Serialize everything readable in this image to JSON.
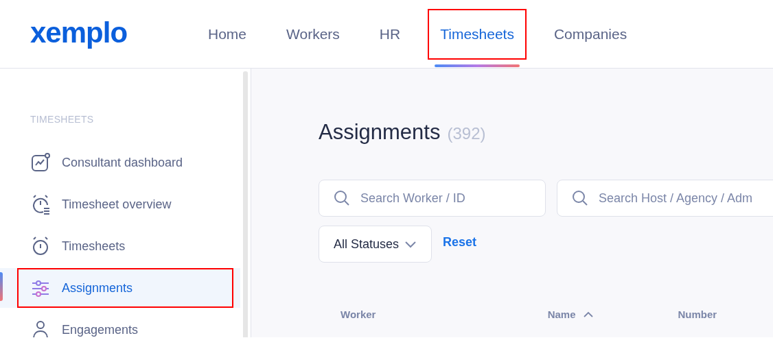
{
  "logo": "xemplo",
  "nav": [
    {
      "label": "Home",
      "selected": false,
      "highlighted": false
    },
    {
      "label": "Workers",
      "selected": false,
      "highlighted": false
    },
    {
      "label": "HR",
      "selected": false,
      "highlighted": false
    },
    {
      "label": "Timesheets",
      "selected": true,
      "highlighted": true
    },
    {
      "label": "Companies",
      "selected": false,
      "highlighted": false
    }
  ],
  "sidebar": {
    "section": "TIMESHEETS",
    "items": [
      {
        "label": "Consultant dashboard",
        "selected": false,
        "highlighted": false
      },
      {
        "label": "Timesheet overview",
        "selected": false,
        "highlighted": false
      },
      {
        "label": "Timesheets",
        "selected": false,
        "highlighted": false
      },
      {
        "label": "Assignments",
        "selected": true,
        "highlighted": true
      },
      {
        "label": "Engagements",
        "selected": false,
        "highlighted": false
      }
    ]
  },
  "page": {
    "title": "Assignments",
    "count": "(392)",
    "searches": [
      {
        "placeholder": "Search Worker / ID"
      },
      {
        "placeholder": "Search Host / Agency / Adm"
      }
    ],
    "status_filter": "All Statuses",
    "reset": "Reset",
    "columns": [
      {
        "label": "Worker",
        "sorted": false
      },
      {
        "label": "Name",
        "sorted": true
      },
      {
        "label": "Number",
        "sorted": false
      }
    ]
  }
}
